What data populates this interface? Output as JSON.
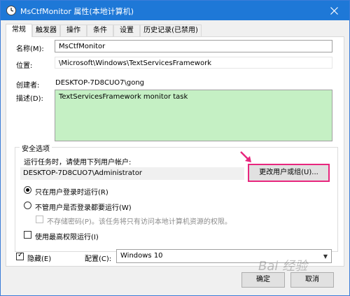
{
  "window": {
    "title": "MsCtfMonitor 属性(本地计算机)",
    "close_label": "✕"
  },
  "tabs": [
    {
      "label": "常规",
      "active": true
    },
    {
      "label": "触发器"
    },
    {
      "label": "操作"
    },
    {
      "label": "条件"
    },
    {
      "label": "设置"
    },
    {
      "label": "历史记录(已禁用)"
    }
  ],
  "general": {
    "name_label": "名称(M):",
    "name_value": "MsCtfMonitor",
    "location_label": "位置:",
    "location_value": "\\Microsoft\\Windows\\TextServicesFramework",
    "author_label": "创建者:",
    "author_value": "DESKTOP-7D8CUO7\\gong",
    "description_label": "描述(D):",
    "description_value": "TextServicesFramework monitor task"
  },
  "security": {
    "group_title": "安全选项",
    "run_as_prompt": "运行任务时，请使用下列用户帐户:",
    "user_account": "DESKTOP-7D8CUO7\\Administrator",
    "change_user_button": "更改用户或组(U)...",
    "radio_logged_on": "只在用户登录时运行(R)",
    "radio_whether_logged_on": "不管用户是否登录都要运行(W)",
    "no_store_password": "不存储密码(P)。该任务将只有访问本地计算机资源的权限。",
    "highest_privileges": "使用最高权限运行(I)"
  },
  "bottom": {
    "hidden_label": "隐藏(E)",
    "configure_label": "配置(C):",
    "configure_value": "Windows 10",
    "ok_button": "确定",
    "cancel_button": "取消"
  },
  "watermark": "Bai 经验",
  "colors": {
    "titlebar": "#1e78d7",
    "highlight_border": "#e8277e",
    "description_bg": "#c5f0c4"
  }
}
